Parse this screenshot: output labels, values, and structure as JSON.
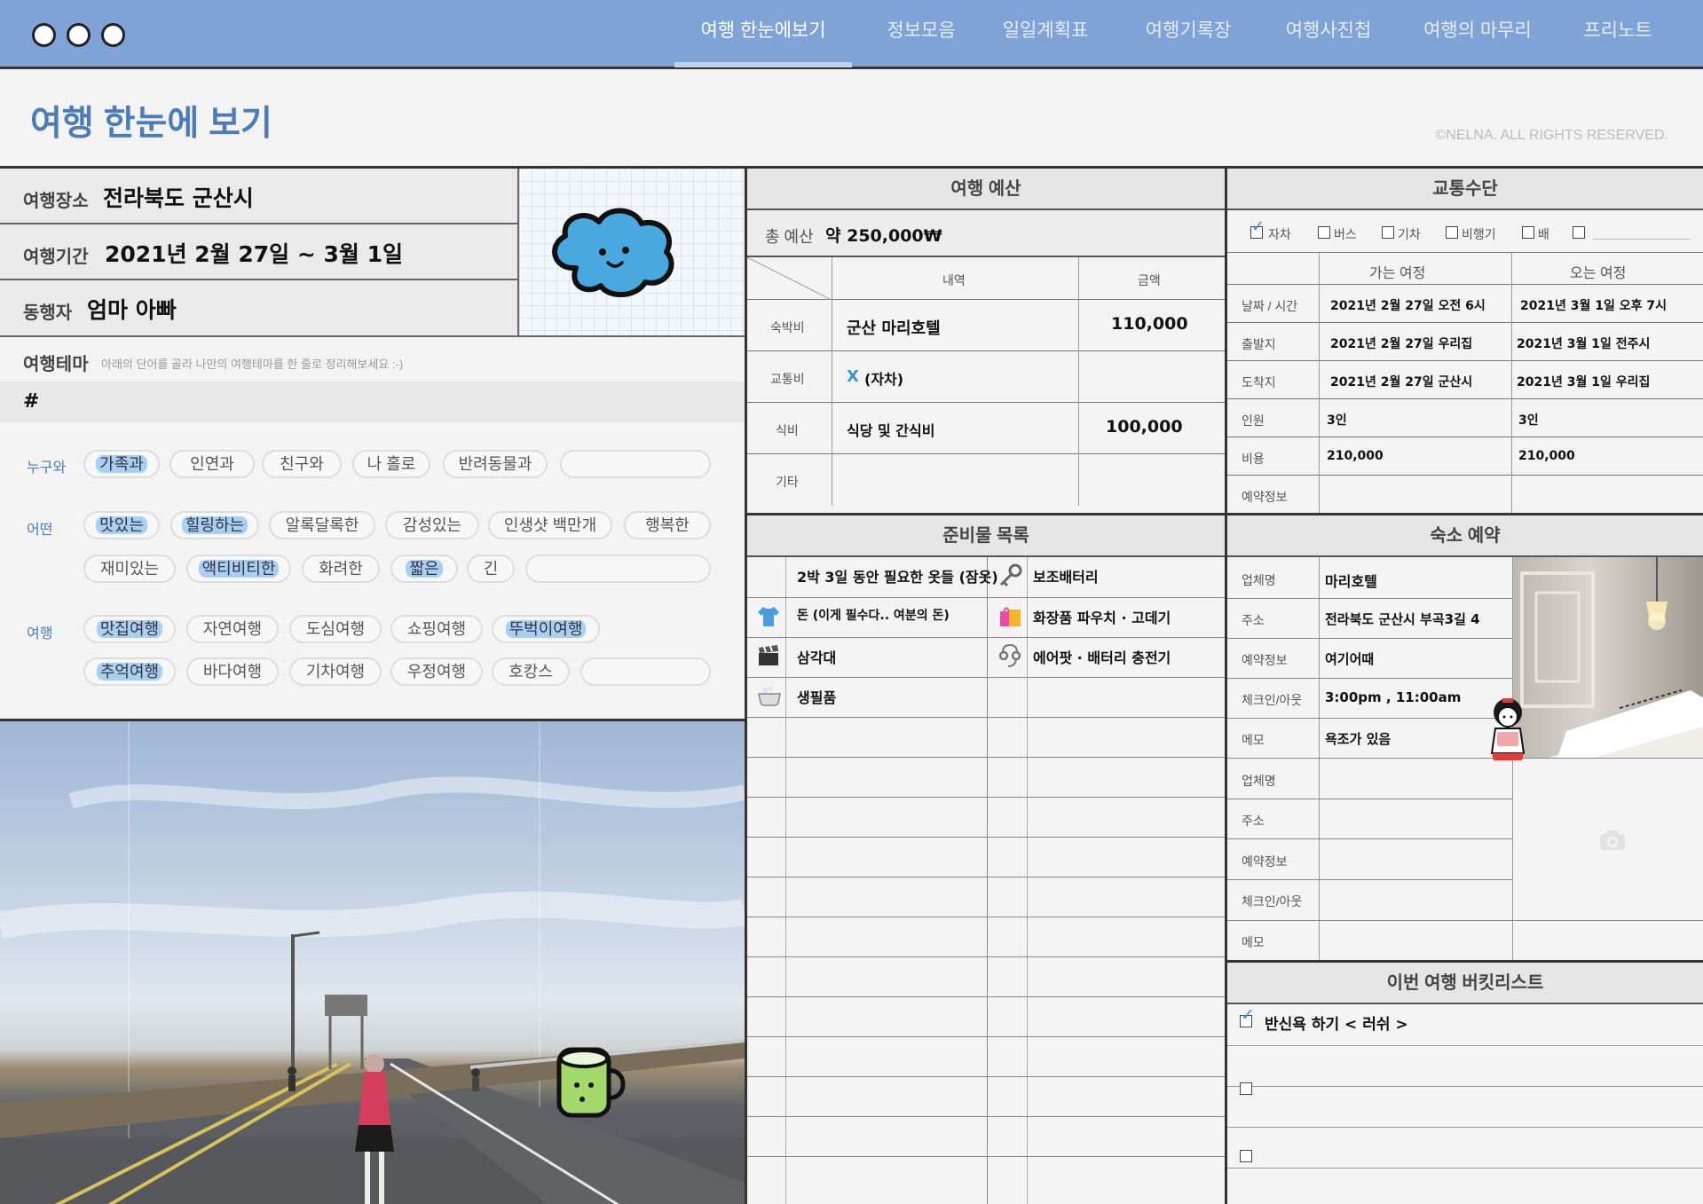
{
  "window": {
    "controls": [
      "control-1",
      "control-2",
      "control-3"
    ]
  },
  "nav": {
    "tabs": [
      {
        "label": "여행 한눈에보기",
        "active": true
      },
      {
        "label": "정보모음"
      },
      {
        "label": "일일계획표"
      },
      {
        "label": "여행기록장"
      },
      {
        "label": "여행사진첩"
      },
      {
        "label": "여행의 마무리"
      },
      {
        "label": "프리노트"
      }
    ]
  },
  "page": {
    "title": "여행 한눈에 보기",
    "copyright": "©NELNA. ALL RIGHTS RESERVED."
  },
  "info": {
    "place_label": "여행장소",
    "place": "전라북도 군산시",
    "period_label": "여행기간",
    "period": "2021년 2월 27일 ~ 3월 1일",
    "companion_label": "동행자",
    "companion": "엄마 아빠"
  },
  "theme": {
    "label": "여행테마",
    "hint": "아래의 단어를 골라 나만의 여행테마를 한 줄로 정리해보세요 :-)",
    "hash": "#",
    "rows": [
      {
        "category": "누구와",
        "chips": [
          {
            "text": "가족과",
            "selected": true
          },
          {
            "text": "인연과"
          },
          {
            "text": "친구와"
          },
          {
            "text": "나 홀로"
          },
          {
            "text": "반려동물과"
          },
          {
            "text": ""
          }
        ]
      },
      {
        "category": "어떤",
        "chips": [
          {
            "text": "맛있는",
            "selected": true
          },
          {
            "text": "힐링하는",
            "selected": true
          },
          {
            "text": "알록달록한"
          },
          {
            "text": "감성있는"
          },
          {
            "text": "인생샷 백만개"
          },
          {
            "text": "행복한"
          }
        ]
      },
      {
        "category": "",
        "chips": [
          {
            "text": "재미있는"
          },
          {
            "text": "액티비티한",
            "selected": true
          },
          {
            "text": "화려한"
          },
          {
            "text": "짧은",
            "selected": true
          },
          {
            "text": "긴"
          },
          {
            "text": ""
          }
        ]
      },
      {
        "category": "여행",
        "chips": [
          {
            "text": "맛집여행",
            "selected": true
          },
          {
            "text": "자연여행"
          },
          {
            "text": "도심여행"
          },
          {
            "text": "쇼핑여행"
          },
          {
            "text": "뚜벅이여행",
            "selected": true
          }
        ]
      },
      {
        "category": "",
        "chips": [
          {
            "text": "추억여행",
            "selected": true
          },
          {
            "text": "바다여행"
          },
          {
            "text": "기차여행"
          },
          {
            "text": "우정여행"
          },
          {
            "text": "호캉스"
          },
          {
            "text": ""
          }
        ]
      }
    ]
  },
  "budget": {
    "title": "여행 예산",
    "total_label": "총 예산",
    "total": "약 250,000₩",
    "col_item": "내역",
    "col_amount": "금액",
    "rows": [
      {
        "label": "숙박비",
        "item": "군산 마리호텔",
        "amount": "110,000"
      },
      {
        "label": "교통비",
        "item_mark": "X",
        "item": "(자차)",
        "amount": ""
      },
      {
        "label": "식비",
        "item": "식당 및 간식비",
        "amount": "100,000"
      },
      {
        "label": "기타",
        "item": "",
        "amount": ""
      }
    ]
  },
  "transport": {
    "title": "교통수단",
    "options": [
      {
        "label": "자차",
        "checked": true
      },
      {
        "label": "버스"
      },
      {
        "label": "기차"
      },
      {
        "label": "비행기"
      },
      {
        "label": "배"
      },
      {
        "label": ""
      }
    ],
    "col_go": "가는 여정",
    "col_return": "오는 여정",
    "rows": [
      {
        "label": "날짜 / 시간",
        "go": "2021년 2월 27일 오전 6시",
        "ret": "2021년 3월 1일 오후 7시"
      },
      {
        "label": "출발지",
        "go": "2021년 2월 27일 우리집",
        "ret": "2021년 3월 1일 전주시"
      },
      {
        "label": "도착지",
        "go": "2021년 2월 27일 군산시",
        "ret": "2021년 3월 1일 우리집"
      },
      {
        "label": "인원",
        "go": "3인",
        "ret": "3인"
      },
      {
        "label": "비용",
        "go": "210,000",
        "ret": "210,000"
      },
      {
        "label": "예약정보",
        "go": "",
        "ret": ""
      }
    ]
  },
  "supplies": {
    "title": "준비물 목록",
    "rows": [
      {
        "left_icon": "",
        "left": "2박 3일 동안 필요한 옷들 (잠옷)",
        "right_icon": "key-icon",
        "right": "보조배터리"
      },
      {
        "left_icon": "shirt-icon",
        "left": "돈 (이게 필수다.. 여분의 돈)",
        "right_icon": "shopping-bag-icon",
        "right": "화장품 파우치 · 고데기"
      },
      {
        "left_icon": "clapperboard-icon",
        "left": "삼각대",
        "right_icon": "earphones-icon",
        "right": "에어팟 · 배터리 충전기"
      },
      {
        "left_icon": "bathtub-icon",
        "left": "생필품",
        "right_icon": "",
        "right": ""
      }
    ]
  },
  "lodging": {
    "title": "숙소 예약",
    "first": [
      {
        "label": "업체명",
        "value": "마리호텔"
      },
      {
        "label": "주소",
        "value": "전라북도 군산시 부곡3길 4"
      },
      {
        "label": "예약정보",
        "value": "여기어때"
      },
      {
        "label": "체크인/아웃",
        "value": "3:00pm , 11:00am"
      },
      {
        "label": "메모",
        "value": "욕조가 있음"
      }
    ],
    "second": [
      {
        "label": "업체명",
        "value": ""
      },
      {
        "label": "주소",
        "value": ""
      },
      {
        "label": "예약정보",
        "value": ""
      },
      {
        "label": "체크인/아웃",
        "value": ""
      },
      {
        "label": "메모",
        "value": ""
      }
    ]
  },
  "bucket": {
    "title": "이번 여행 버킷리스트",
    "items": [
      {
        "text": "반신욕 하기 < 러쉬 >",
        "checked": true
      },
      {
        "text": "",
        "checked": false
      },
      {
        "text": "",
        "checked": false
      }
    ]
  },
  "colors": {
    "accent": "#7fa3d6",
    "title_blue": "#4b7cb8",
    "chip_highlight": "#a9cff2"
  }
}
